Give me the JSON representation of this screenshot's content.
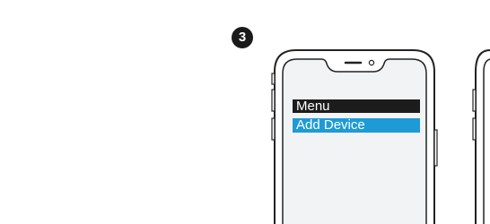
{
  "step": {
    "number": "3"
  },
  "phone": {
    "screen": {
      "menu_title": "Menu",
      "selected_item": "Add Device"
    }
  },
  "colors": {
    "badge_bg": "#1a1a1a",
    "menu_title_bg": "#1c1c1c",
    "selected_item_bg": "#1e9bd7",
    "screen_bg": "#f2f3f4",
    "outline": "#222222"
  }
}
